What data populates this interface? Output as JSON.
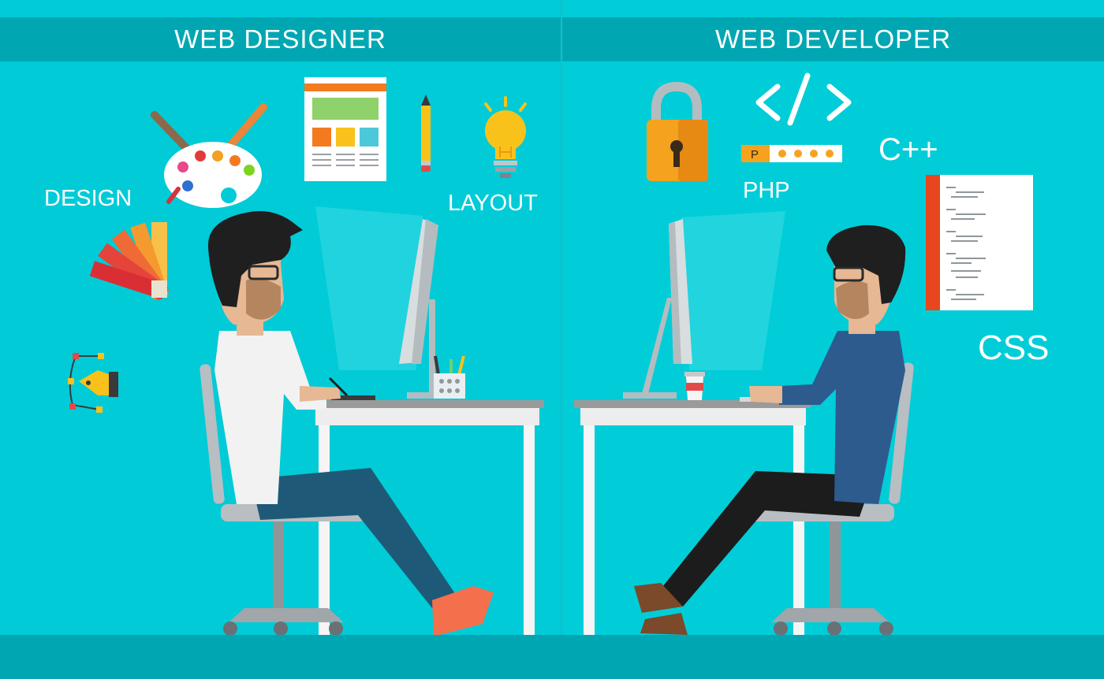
{
  "panels": {
    "left": {
      "heading": "WEB DESIGNER",
      "labels": {
        "design": "DESIGN",
        "layout": "LAYOUT"
      },
      "icons": [
        "paint-palette-icon",
        "webpage-mockup-icon",
        "pencil-icon",
        "lightbulb-icon",
        "color-swatch-icon",
        "pen-tool-icon"
      ]
    },
    "right": {
      "heading": "WEB DEVELOPER",
      "labels": {
        "php": "PHP",
        "cpp": "C++",
        "css": "CSS"
      },
      "password_prefix": "P",
      "icons": [
        "padlock-icon",
        "code-brackets-icon",
        "password-field-icon",
        "code-document-icon"
      ]
    }
  },
  "colors": {
    "background": "#00cbd7",
    "banner": "#00a7b2",
    "floor": "#00a7b2",
    "desk": "#9a9a9a",
    "designer_shirt": "#f2f2f2",
    "developer_shirt": "#2d5b8e",
    "accent_orange": "#f59a1a"
  }
}
